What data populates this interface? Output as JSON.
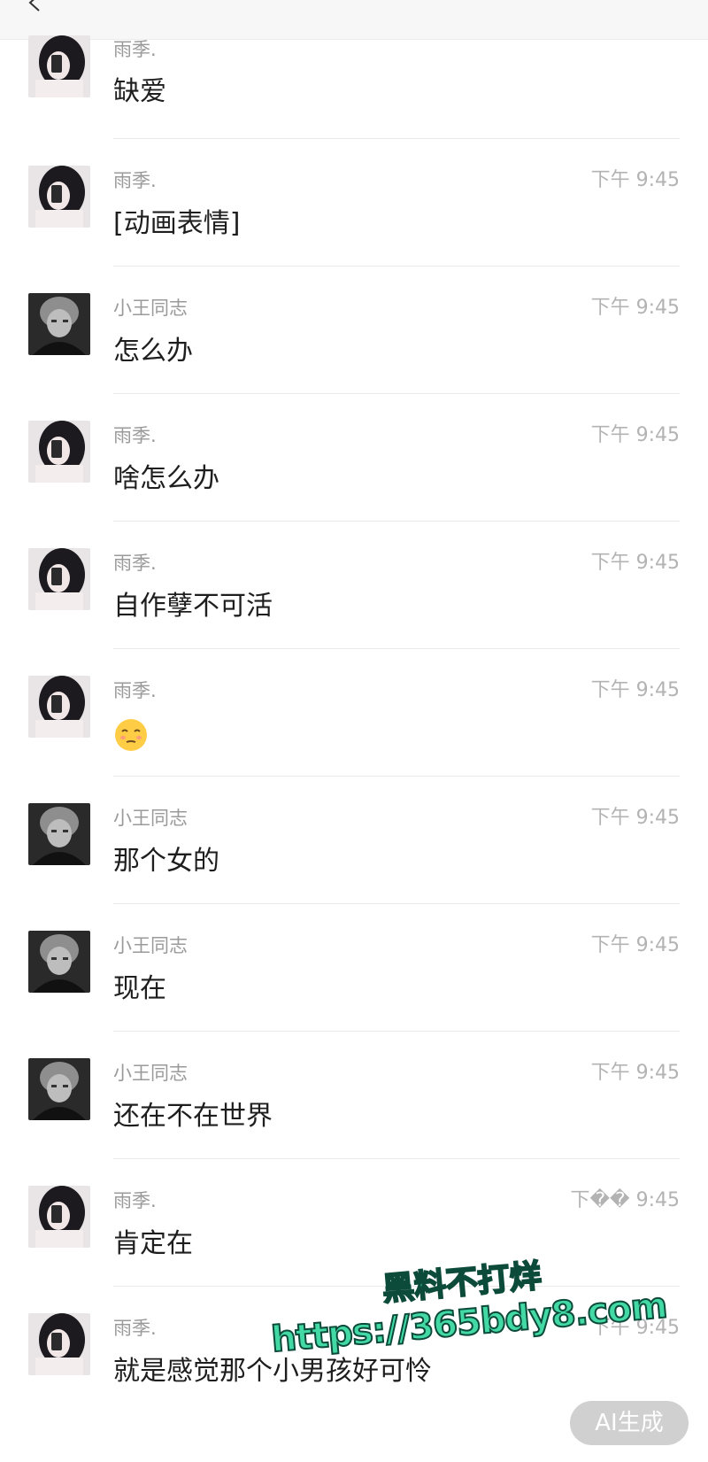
{
  "senders": {
    "female": "雨季.",
    "male": "小王同志"
  },
  "messages": [
    {
      "sender": "雨季.",
      "time": "",
      "text": "缺爱",
      "avatar": "female-avatar"
    },
    {
      "sender": "雨季.",
      "time": "下午 9:45",
      "text": "[动画表情]",
      "avatar": "female-avatar"
    },
    {
      "sender": "小王同志",
      "time": "下午 9:45",
      "text": "怎么办",
      "avatar": "male-avatar"
    },
    {
      "sender": "雨季.",
      "time": "下午 9:45",
      "text": "啥怎么办",
      "avatar": "female-avatar"
    },
    {
      "sender": "雨季.",
      "time": "下午 9:45",
      "text": "自作孽不可活",
      "avatar": "female-avatar"
    },
    {
      "sender": "雨季.",
      "time": "下午 9:45",
      "text": "",
      "emoji": "unamused-face-emoji",
      "avatar": "female-avatar"
    },
    {
      "sender": "小王同志",
      "time": "下午 9:45",
      "text": "那个女的",
      "avatar": "male-avatar"
    },
    {
      "sender": "小王同志",
      "time": "下午 9:45",
      "text": "现在",
      "avatar": "male-avatar"
    },
    {
      "sender": "小王同志",
      "time": "下午 9:45",
      "text": "还在不在世界",
      "avatar": "male-avatar"
    },
    {
      "sender": "雨季.",
      "time": "下�� 9:45",
      "text": "肯定在",
      "avatar": "female-avatar"
    },
    {
      "sender": "雨季.",
      "time": "下午 9:45",
      "text": "就是感觉那个小男孩好可怜",
      "avatar": "female-avatar"
    }
  ],
  "watermark": {
    "line1": "黑料不打烊",
    "line2": "https://365bdy8.com"
  },
  "ai_badge": "AI生成",
  "icons": {
    "back": "back-arrow-icon"
  },
  "colors": {
    "sender": "#9a9a9a",
    "time": "#b3b3b3",
    "message": "#1e1e1e",
    "watermark_fill": "#42d9a4",
    "watermark_stroke": "#0c4a3a"
  }
}
